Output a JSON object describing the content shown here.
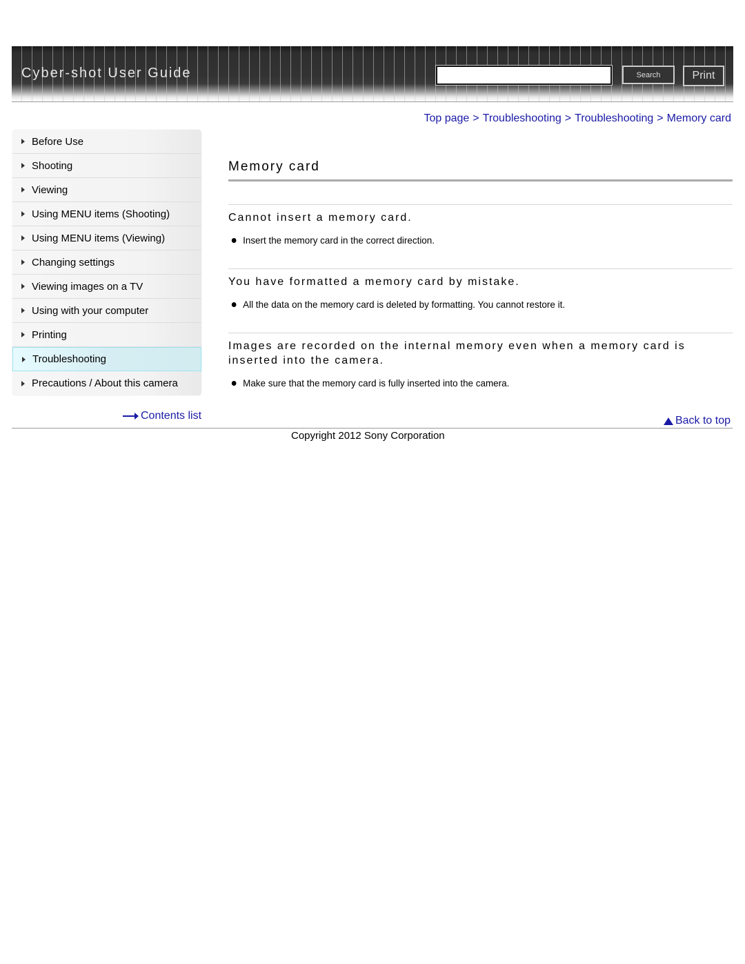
{
  "header": {
    "title": "Cyber-shot User Guide",
    "search_placeholder": "",
    "search_value": "",
    "search_button": "Search",
    "print_button": "Print"
  },
  "breadcrumb": [
    "Top page",
    "Troubleshooting",
    "Troubleshooting",
    "Memory card"
  ],
  "breadcrumb_separator": ">",
  "sidebar": {
    "items": [
      {
        "label": "Before Use"
      },
      {
        "label": "Shooting"
      },
      {
        "label": "Viewing"
      },
      {
        "label": "Using MENU items (Shooting)"
      },
      {
        "label": "Using MENU items (Viewing)"
      },
      {
        "label": "Changing settings"
      },
      {
        "label": "Viewing images on a TV"
      },
      {
        "label": "Using with your computer"
      },
      {
        "label": "Printing"
      },
      {
        "label": "Troubleshooting",
        "active": true
      },
      {
        "label": "Precautions / About this camera"
      }
    ],
    "contents_list": "Contents list"
  },
  "main": {
    "title": "Memory card",
    "sections": [
      {
        "heading": "Cannot insert a memory card.",
        "bullets": [
          "Insert the memory card in the correct direction."
        ]
      },
      {
        "heading": "You have formatted a memory card by mistake.",
        "bullets": [
          "All the data on the memory card is deleted by formatting. You cannot restore it."
        ]
      },
      {
        "heading": "Images are recorded on the internal memory even when a memory card is inserted into the camera.",
        "bullets": [
          "Make sure that the memory card is fully inserted into the camera."
        ]
      }
    ]
  },
  "footer": {
    "back_to_top": "Back to top",
    "copyright": "Copyright 2012 Sony Corporation"
  },
  "colors": {
    "link": "#1a1aa6",
    "active_nav": "#d6eef3",
    "header_bg": "#333333"
  }
}
